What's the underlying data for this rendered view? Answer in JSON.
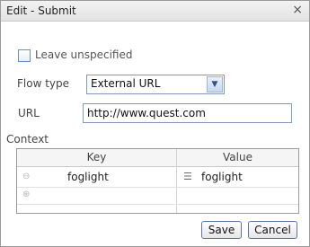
{
  "dialog": {
    "title": "Edit - Submit",
    "close_icon": "×"
  },
  "form": {
    "leave_unspecified_label": "Leave unspecified",
    "leave_unspecified_checked": false,
    "flow_type_label": "Flow type",
    "flow_type_value": "External URL",
    "url_label": "URL",
    "url_value": "http://www.quest.com",
    "context_label": "Context"
  },
  "context_table": {
    "columns": [
      "Key",
      "Value"
    ],
    "rows": [
      {
        "key": "foglight",
        "value": "foglight"
      }
    ]
  },
  "icons": {
    "remove_row": "minus-circle-icon",
    "add_row": "plus-circle-icon",
    "value_type": "list-type-icon",
    "dropdown": "chevron-down-icon"
  },
  "buttons": {
    "save": "Save",
    "cancel": "Cancel"
  }
}
